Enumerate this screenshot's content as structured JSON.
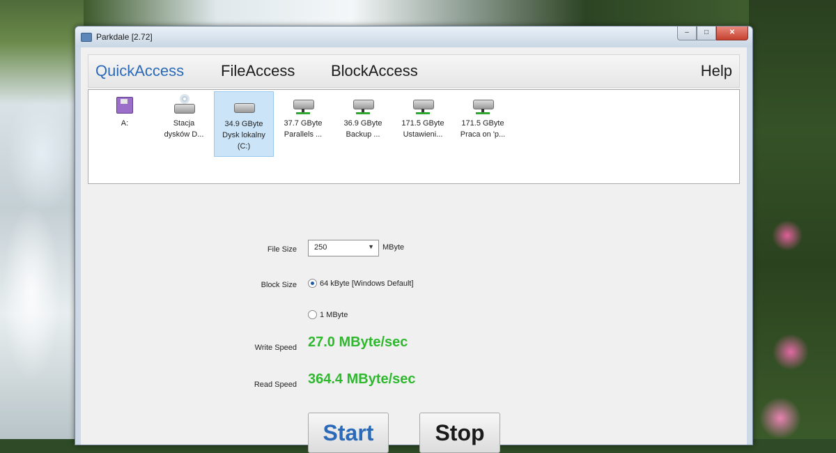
{
  "window": {
    "title": "Parkdale [2.72]"
  },
  "nav": {
    "tabs": [
      {
        "label": "QuickAccess",
        "active": true
      },
      {
        "label": "FileAccess",
        "active": false
      },
      {
        "label": "BlockAccess",
        "active": false
      }
    ],
    "help_label": "Help"
  },
  "drives": [
    {
      "line1": "A:",
      "line2": "",
      "line3": "",
      "icon": "floppy-drive-icon",
      "selected": false
    },
    {
      "line1": "Stacja",
      "line2": "dysków D...",
      "line3": "",
      "icon": "cd-drive-icon",
      "selected": false
    },
    {
      "line1": "34.9 GByte",
      "line2": "Dysk lokalny",
      "line3": "(C:)",
      "icon": "hard-drive-icon",
      "selected": true
    },
    {
      "line1": "37.7 GByte",
      "line2": "Parallels ...",
      "line3": "",
      "icon": "network-drive-icon",
      "selected": false
    },
    {
      "line1": "36.9 GByte",
      "line2": "Backup ...",
      "line3": "",
      "icon": "network-drive-icon",
      "selected": false
    },
    {
      "line1": "171.5 GByte",
      "line2": "Ustawieni...",
      "line3": "",
      "icon": "network-drive-icon",
      "selected": false
    },
    {
      "line1": "171.5 GByte",
      "line2": "Praca on 'p...",
      "line3": "",
      "icon": "network-drive-icon",
      "selected": false
    }
  ],
  "form": {
    "file_size_label": "File Size",
    "file_size_value": "250",
    "file_size_unit": "MByte",
    "block_size_label": "Block Size",
    "block_size_option_1": "64 kByte [Windows Default]",
    "block_size_option_2": "1 MByte",
    "write_speed_label": "Write Speed",
    "write_speed_value": "27.0 MByte/sec",
    "read_speed_label": "Read Speed",
    "read_speed_value": "364.4 MByte/sec"
  },
  "buttons": {
    "start_label": "Start",
    "stop_label": "Stop"
  },
  "colors": {
    "accent_blue": "#2a6ab8",
    "speed_green": "#2eb82e"
  }
}
